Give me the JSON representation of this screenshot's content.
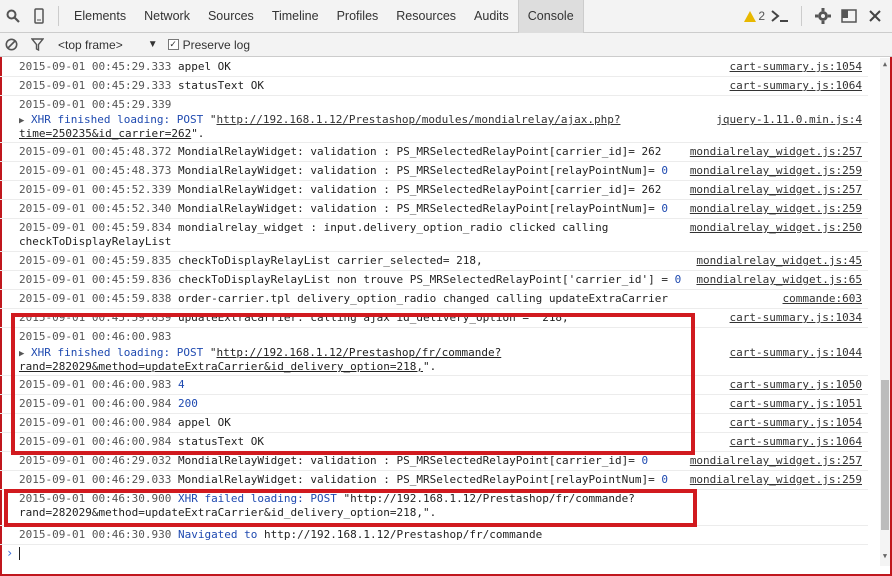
{
  "toolbar": {
    "tabs": [
      "Elements",
      "Network",
      "Sources",
      "Timeline",
      "Profiles",
      "Resources",
      "Audits",
      "Console"
    ],
    "active_tab": "Console",
    "warning_count": "2"
  },
  "subbar": {
    "frame_selector": "<top frame>",
    "preserve_log_label": "Preserve log",
    "preserve_log_checked": "✓"
  },
  "rows": [
    {
      "ts": "2015-09-01 00:45:29.333",
      "msg": " appel OK",
      "src": "cart-summary.js:1054"
    },
    {
      "ts": "2015-09-01 00:45:29.333",
      "msg": " statusText OK",
      "src": "cart-summary.js:1064"
    },
    {
      "ts": "2015-09-01 00:45:29.339",
      "msg": "",
      "src": ""
    },
    {
      "xhr1a": "XHR finished loading: POST ",
      "xhr1url": "http://192.168.1.12/Prestashop/modules/mondialrelay/ajax.php?",
      "xhr1b": "time=250235&id_carrier=262",
      "xhr1end": "\".",
      "src": "jquery-1.11.0.min.js:4"
    },
    {
      "ts": "2015-09-01 00:45:48.372",
      "msg": " MondialRelayWidget: validation : PS_MRSelectedRelayPoint[carrier_id]= 262",
      "src": "mondialrelay_widget.js:257"
    },
    {
      "ts": "2015-09-01 00:45:48.373",
      "msg": " MondialRelayWidget: validation : PS_MRSelectedRelayPoint[relayPointNum]= ",
      "val": "0",
      "src": "mondialrelay_widget.js:259"
    },
    {
      "ts": "2015-09-01 00:45:52.339",
      "msg": " MondialRelayWidget: validation : PS_MRSelectedRelayPoint[carrier_id]= 262",
      "src": "mondialrelay_widget.js:257"
    },
    {
      "ts": "2015-09-01 00:45:52.340",
      "msg": " MondialRelayWidget: validation : PS_MRSelectedRelayPoint[relayPointNum]= ",
      "val": "0",
      "src": "mondialrelay_widget.js:259"
    },
    {
      "ts": "2015-09-01 00:45:59.834",
      "msg": " mondialrelay_widget : input.delivery_option_radio clicked calling",
      "msg2": "checkToDisplayRelayList",
      "src": "mondialrelay_widget.js:250"
    },
    {
      "ts": "2015-09-01 00:45:59.835",
      "msg": " checkToDisplayRelayList carrier_selected= 218,",
      "src": "mondialrelay_widget.js:45"
    },
    {
      "ts": "2015-09-01 00:45:59.836",
      "msg": " checkToDisplayRelayList non trouve PS_MRSelectedRelayPoint['carrier_id'] = ",
      "val": "0",
      "src": "mondialrelay_widget.js:65"
    },
    {
      "ts": "2015-09-01 00:45:59.838",
      "msg": " order-carrier.tpl delivery_option_radio changed calling updateExtraCarrier",
      "src": "commande:603"
    },
    {
      "ts": "2015-09-01 00:45:59.839",
      "msg": " updateExtraCarrier: calling ajax id_delivery_option =  218,",
      "src": "cart-summary.js:1034"
    },
    {
      "ts": "2015-09-01 00:46:00.983",
      "msg": "",
      "src": ""
    },
    {
      "xhr2a": "XHR finished loading: POST ",
      "xhr2url": "http://192.168.1.12/Prestashop/fr/commande?",
      "xhr2b": "rand=282029&method=updateExtraCarrier&id_delivery_option=218,",
      "xhr2end": "\".",
      "src": "cart-summary.js:1044"
    },
    {
      "ts": "2015-09-01 00:46:00.983",
      "val": "4",
      "src": "cart-summary.js:1050"
    },
    {
      "ts": "2015-09-01 00:46:00.984",
      "val": "200",
      "src": "cart-summary.js:1051"
    },
    {
      "ts": "2015-09-01 00:46:00.984",
      "msg": " appel OK",
      "src": "cart-summary.js:1054"
    },
    {
      "ts": "2015-09-01 00:46:00.984",
      "msg": " statusText OK",
      "src": "cart-summary.js:1064"
    },
    {
      "ts": "2015-09-01 00:46:29.032",
      "msg": " MondialRelayWidget: validation : PS_MRSelectedRelayPoint[carrier_id]= ",
      "val": "0",
      "src": "mondialrelay_widget.js:257"
    },
    {
      "ts": "2015-09-01 00:46:29.033",
      "msg": " MondialRelayWidget: validation : PS_MRSelectedRelayPoint[relayPointNum]= ",
      "val": "0",
      "src": "mondialrelay_widget.js:259"
    },
    {
      "ts": "2015-09-01 00:46:30.900",
      "fail": " XHR failed loading: POST ",
      "failurl": "\"http://192.168.1.12/Prestashop/fr/commande?",
      "fail2": "rand=282029&method=updateExtraCarrier&id_delivery_option=218,\".",
      "src": ""
    },
    {
      "ts": "2015-09-01 00:46:30.930",
      "nav": " Navigated to ",
      "navurl": "http://192.168.1.12/Prestashop/fr/commande",
      "src": ""
    }
  ],
  "colors": {
    "highlight": "#d11a1f",
    "blue_text": "#1f4ab0",
    "prompt": "#3a6bd6"
  }
}
